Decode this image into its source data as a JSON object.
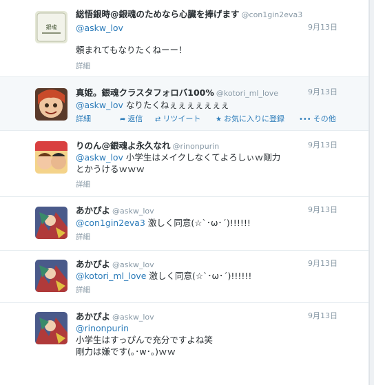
{
  "tweets": [
    {
      "fullname": "総悟銀時@銀魂のためなら心臓を捧げます",
      "screen_name": "@con1gin2eva3",
      "time": "9月13日",
      "lines": [
        {
          "mention": "@askw_lov",
          "text": ""
        },
        {
          "mention": "",
          "text": ""
        },
        {
          "mention": "",
          "text": "頼まれてもなりたくねーー！"
        }
      ],
      "detail": "詳細",
      "avatar_color": "#dfe3cf"
    },
    {
      "fullname": "真姫。銀魂クラスタフォロバ100%",
      "screen_name": "@kotori_ml_love",
      "time": "9月13日",
      "lines": [
        {
          "mention": "@askw_lov",
          "text": " なりたくねぇぇぇぇぇぇぇ"
        }
      ],
      "detail": "詳細",
      "actions": {
        "reply": "返信",
        "retweet": "リツイート",
        "favorite": "お気に入りに登録",
        "more": "その他"
      },
      "avatar_color": "#c0563a"
    },
    {
      "fullname": "りのん@銀魂よ永久なれ",
      "screen_name": "@rinonpurin",
      "time": "9月13日",
      "lines": [
        {
          "mention": "@askw_lov",
          "text": " 小学生はメイクしなくてよろしぃｗ剛力"
        },
        {
          "mention": "",
          "text": "とかうけるｗｗｗ"
        }
      ],
      "detail": "詳細",
      "avatar_color": "#e3a04a"
    },
    {
      "fullname": "あかぴよ",
      "screen_name": "@askw_lov",
      "time": "9月13日",
      "lines": [
        {
          "mention": "@con1gin2eva3",
          "text": " 激しく同意(☆`･ω･´)!!!!!!"
        }
      ],
      "detail": "詳細",
      "avatar_color": "#6a5a8e"
    },
    {
      "fullname": "あかぴよ",
      "screen_name": "@askw_lov",
      "time": "9月13日",
      "lines": [
        {
          "mention": "@kotori_ml_love",
          "text": " 激しく同意(☆`･ω･´)!!!!!!"
        }
      ],
      "detail": "詳細",
      "avatar_color": "#6a5a8e"
    },
    {
      "fullname": "あかぴよ",
      "screen_name": "@askw_lov",
      "time": "9月13日",
      "lines": [
        {
          "mention": "@rinonpurin",
          "text": ""
        },
        {
          "mention": "",
          "text": "小学生はすっぴんで充分ですよね笑"
        },
        {
          "mention": "",
          "text": "剛力は嫌です(｡･w･｡)ｗｗ"
        }
      ],
      "detail": "詳細",
      "avatar_color": "#6a5a8e"
    }
  ]
}
